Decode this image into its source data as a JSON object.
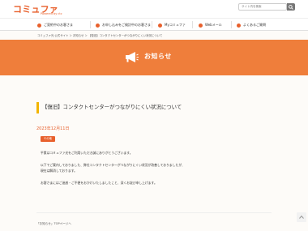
{
  "header": {
    "logo": "コミュファ",
    "logo_sub": "Powered by ctc",
    "search_placeholder": "サイト内を検索"
  },
  "nav": {
    "items": [
      {
        "label": "ご契約中のお客さま"
      },
      {
        "label": "お申し込みをご検討中のお客さま"
      },
      {
        "label": "Myコミュファ"
      },
      {
        "label": "Webメール"
      },
      {
        "label": "よくあるご質問"
      }
    ]
  },
  "breadcrumb": "コミュファ光 公式サイト ＞ お知らせ ＞ 【復旧】コンタクトセンターがつながりにくい状況について",
  "banner": {
    "title": "お知らせ"
  },
  "article": {
    "title": "【復旧】コンタクトセンターがつながりにくい状況について",
    "date": "2023年12月11日",
    "tag": "その他",
    "paragraphs": [
      "平素はコミュファ光をご利用いただき誠にありがとうございます。",
      "以下でご案内しておりました、弊社コンタクトセンターがつながりにくい状況が改善しておりましたが、",
      "現在は解消しております。",
      "お客さまにはご迷惑・ご不便をおかけいたしましたこと、深くお詫び申し上げます。"
    ]
  },
  "footer": {
    "back_link": "「お知らせ」TOPページへ"
  },
  "colors": {
    "accent": "#e8602c",
    "banner": "#ef7e3b",
    "title_bar": "#f2b400"
  }
}
